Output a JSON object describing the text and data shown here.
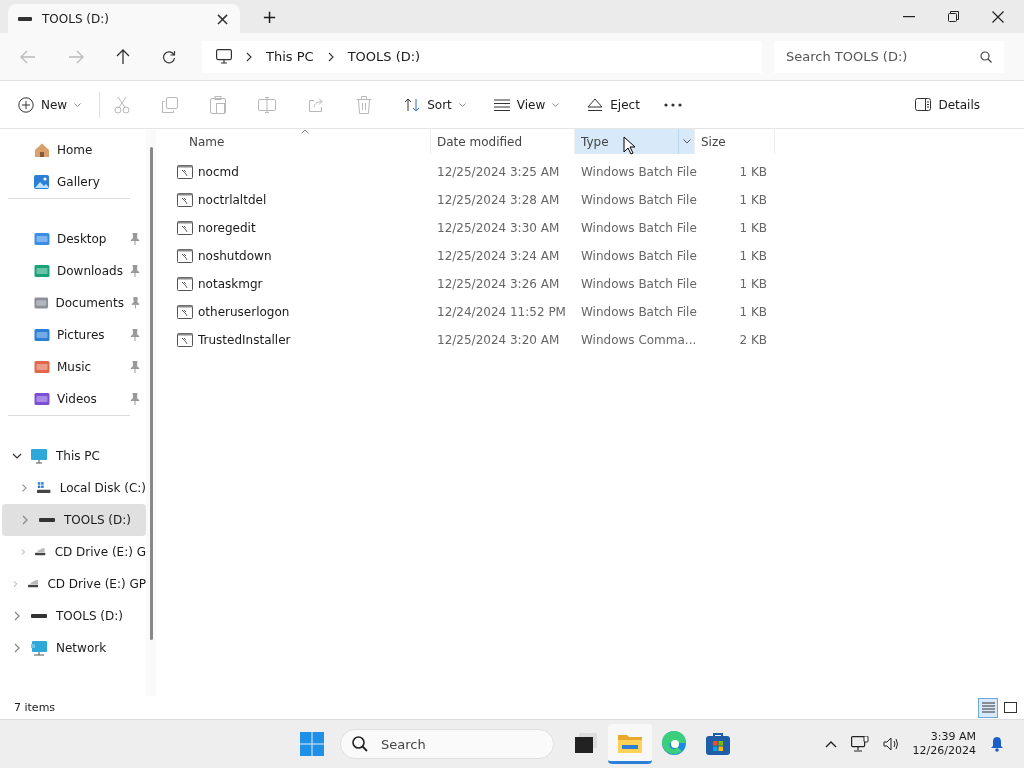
{
  "tab": {
    "title": "TOOLS (D:)",
    "close": "×",
    "new_tab": "+"
  },
  "address": {
    "crumbs": [
      "This PC",
      "TOOLS (D:)"
    ],
    "search_placeholder": "Search TOOLS (D:)"
  },
  "commands": [
    {
      "kind": "new",
      "label": "New",
      "disabled": false
    },
    {
      "kind": "cut",
      "disabled": true
    },
    {
      "kind": "copy",
      "disabled": true
    },
    {
      "kind": "paste",
      "disabled": true
    },
    {
      "kind": "rename",
      "disabled": true
    },
    {
      "kind": "share",
      "disabled": true
    },
    {
      "kind": "delete",
      "disabled": true
    },
    {
      "kind": "sort",
      "label": "Sort",
      "disabled": false
    },
    {
      "kind": "view",
      "label": "View",
      "disabled": false
    },
    {
      "kind": "eject",
      "label": "Eject",
      "disabled": false
    },
    {
      "kind": "more",
      "disabled": false
    }
  ],
  "details_button": "Details",
  "sidebar": {
    "top": [
      {
        "label": "Home"
      },
      {
        "label": "Gallery"
      }
    ],
    "quick_access": [
      {
        "label": "Desktop",
        "pinned": true
      },
      {
        "label": "Downloads",
        "pinned": true
      },
      {
        "label": "Documents",
        "pinned": true
      },
      {
        "label": "Pictures",
        "pinned": true
      },
      {
        "label": "Music",
        "pinned": true
      },
      {
        "label": "Videos",
        "pinned": true
      }
    ],
    "tree": [
      {
        "label": "This PC",
        "kind": "pc",
        "expanded": true,
        "selected": false,
        "children": [
          {
            "label": "Local Disk (C:)",
            "kind": "disk",
            "expanded": false,
            "selected": false
          },
          {
            "label": "TOOLS (D:)",
            "kind": "drive",
            "expanded": false,
            "selected": true
          },
          {
            "label": "CD Drive (E:) G",
            "kind": "cd",
            "expanded": false,
            "selected": false
          }
        ]
      },
      {
        "label": "CD Drive (E:) GP",
        "kind": "cd",
        "expanded": false,
        "selected": false
      },
      {
        "label": "TOOLS (D:)",
        "kind": "drive",
        "expanded": false,
        "selected": false
      },
      {
        "label": "Network",
        "kind": "network",
        "expanded": false,
        "selected": false
      }
    ]
  },
  "table": {
    "columns": [
      {
        "label": "Name",
        "hovered": false,
        "sorted": true
      },
      {
        "label": "Date modified",
        "hovered": false,
        "sorted": false
      },
      {
        "label": "Type",
        "hovered": true,
        "sorted": false
      },
      {
        "label": "Size",
        "hovered": false,
        "sorted": false
      }
    ],
    "rows": [
      [
        "nocmd",
        "12/25/2024 3:25 AM",
        "Windows Batch File",
        "1 KB"
      ],
      [
        "noctrlaltdel",
        "12/25/2024 3:28 AM",
        "Windows Batch File",
        "1 KB"
      ],
      [
        "noregedit",
        "12/25/2024 3:30 AM",
        "Windows Batch File",
        "1 KB"
      ],
      [
        "noshutdown",
        "12/25/2024 3:24 AM",
        "Windows Batch File",
        "1 KB"
      ],
      [
        "notaskmgr",
        "12/25/2024 3:26 AM",
        "Windows Batch File",
        "1 KB"
      ],
      [
        "otheruserlogon",
        "12/24/2024 11:52 PM",
        "Windows Batch File",
        "1 KB"
      ],
      [
        "TrustedInstaller",
        "12/25/2024 3:20 AM",
        "Windows Comma...",
        "2 KB"
      ]
    ]
  },
  "status_bar": {
    "count": "7 items",
    "views": [
      {
        "kind": "details",
        "selected": true
      },
      {
        "kind": "tiles",
        "selected": false
      }
    ]
  },
  "taskbar": {
    "search_placeholder": "Search",
    "apps": [
      {
        "kind": "taskview",
        "active": false
      },
      {
        "kind": "explorer",
        "active": true
      },
      {
        "kind": "edge",
        "active": false
      },
      {
        "kind": "store",
        "active": false
      }
    ],
    "time": "3:39 AM",
    "date": "12/26/2024"
  }
}
